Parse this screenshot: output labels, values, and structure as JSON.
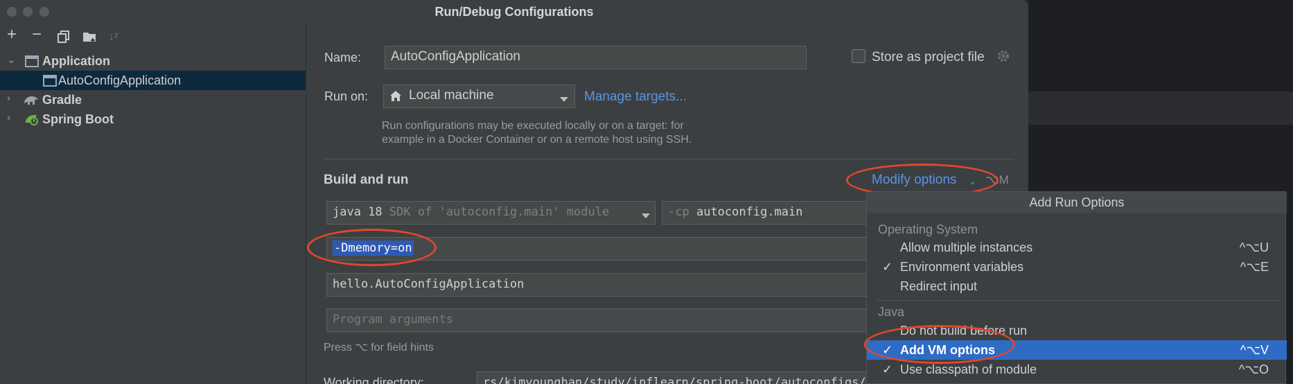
{
  "window": {
    "title": "Run/Debug Configurations"
  },
  "toolbar": {
    "add": "+",
    "remove": "−",
    "sort": "↓ᶻ"
  },
  "tree": [
    {
      "label": "Application",
      "expanded": true
    },
    {
      "label": "AutoConfigApplication",
      "selected": true
    },
    {
      "label": "Gradle",
      "expanded": false
    },
    {
      "label": "Spring Boot",
      "expanded": false
    }
  ],
  "form": {
    "name_label": "Name:",
    "name_value": "AutoConfigApplication",
    "store_label": "Store as project file",
    "run_on_label": "Run on:",
    "run_on_value": "Local machine",
    "manage_targets": "Manage targets...",
    "help_text_1": "Run configurations may be executed locally or on a target: for",
    "help_text_2": "example in a Docker Container or on a remote host using SSH.",
    "build_run_title": "Build and run",
    "modify_options": "Modify options",
    "modify_shortcut": "⌥M",
    "jdk_version": "java 18",
    "jdk_desc": "SDK of 'autoconfig.main' module",
    "cp_prefix": "-cp",
    "cp_value": "autoconfig.main",
    "vm_options": "-Dmemory=on",
    "main_class": "hello.AutoConfigApplication",
    "program_args_placeholder": "Program arguments",
    "field_hint": "Press ⌥ for field hints",
    "working_dir_label": "Working directory:",
    "working_dir_value": "rs/kimyounghan/study/inflearn/spring-boot/autoconfigs/au"
  },
  "popup": {
    "title": "Add Run Options",
    "groups": [
      {
        "name": "Operating System",
        "items": [
          {
            "label": "Allow multiple instances",
            "shortcut": "^⌥U",
            "checked": false
          },
          {
            "label": "Environment variables",
            "shortcut": "^⌥E",
            "checked": true
          },
          {
            "label": "Redirect input",
            "shortcut": "",
            "checked": false
          }
        ]
      },
      {
        "name": "Java",
        "items": [
          {
            "label": "Do not build before run",
            "shortcut": "",
            "checked": false
          },
          {
            "label": "Add VM options",
            "shortcut": "^⌥V",
            "checked": true,
            "selected": true
          },
          {
            "label": "Use classpath of module",
            "shortcut": "^⌥O",
            "checked": true
          }
        ]
      }
    ]
  },
  "colors": {
    "accent": "#5895e8",
    "annotation": "#e0482b",
    "selection": "#2e6bc5"
  }
}
